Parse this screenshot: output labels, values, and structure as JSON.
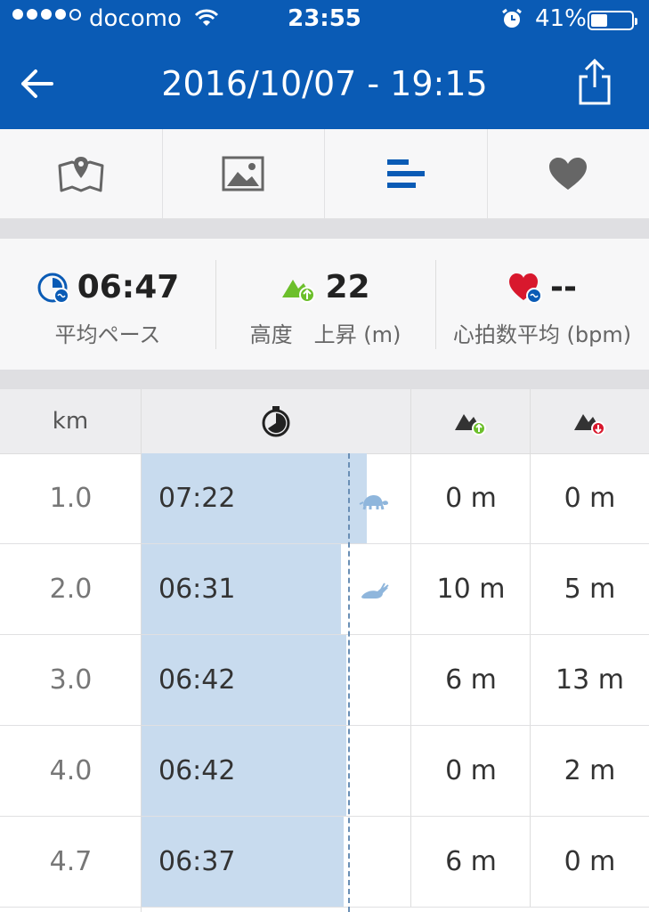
{
  "status_bar": {
    "carrier": "docomo",
    "time": "23:55",
    "battery": "41%",
    "battery_level": 0.41
  },
  "header": {
    "title": "2016/10/07 - 19:15"
  },
  "tabs": [
    {
      "icon": "map-icon"
    },
    {
      "icon": "image-icon"
    },
    {
      "icon": "splits-icon",
      "active": true
    },
    {
      "icon": "heart-icon"
    }
  ],
  "summary": {
    "pace": {
      "value": "06:47",
      "label": "平均ペース"
    },
    "elevation": {
      "value": "22",
      "label": "高度　上昇 (m)"
    },
    "heart_rate": {
      "value": "--",
      "label": "心拍数平均 (bpm)"
    }
  },
  "splits": {
    "headers": {
      "km": "km"
    },
    "rows": [
      {
        "km": "1.0",
        "pace": "07:22",
        "pace_fraction": 0.835,
        "up": "0 m",
        "down": "0 m",
        "marker": "turtle-icon"
      },
      {
        "km": "2.0",
        "pace": "06:31",
        "pace_fraction": 0.74,
        "up": "10 m",
        "down": "5 m",
        "marker": "rabbit-icon"
      },
      {
        "km": "3.0",
        "pace": "06:42",
        "pace_fraction": 0.76,
        "up": "6 m",
        "down": "13 m"
      },
      {
        "km": "4.0",
        "pace": "06:42",
        "pace_fraction": 0.76,
        "up": "0 m",
        "down": "2 m"
      },
      {
        "km": "4.7",
        "pace": "06:37",
        "pace_fraction": 0.75,
        "up": "6 m",
        "down": "0 m"
      }
    ]
  },
  "colors": {
    "header_bg": "#0a5bb5",
    "accent": "#0a5bb5",
    "pace_bar": "#c8dbee",
    "heart": "#d8182d",
    "elev_up": "#6cbf2b",
    "elev_down": "#d8182d"
  }
}
